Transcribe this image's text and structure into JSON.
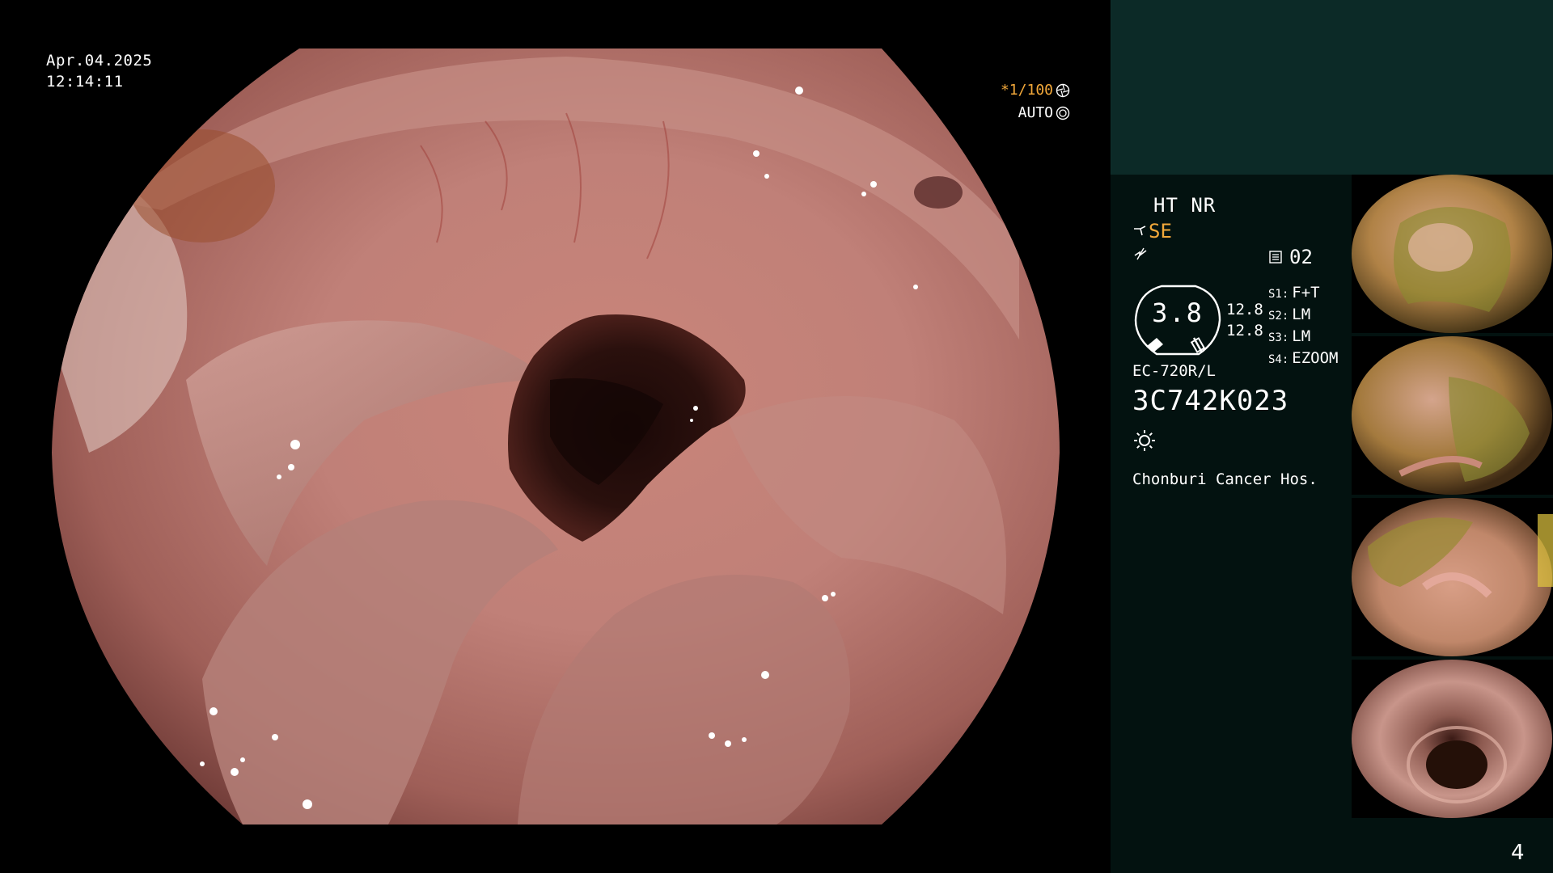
{
  "overlay": {
    "date": "Apr.04.2025",
    "time": "12:14:11",
    "shutter": "*1/100",
    "mode": "AUTO"
  },
  "panel": {
    "ht_nr": "HT NR",
    "se": "SE",
    "channel": "02",
    "gauge_value": "3.8",
    "side_values": [
      "12.8",
      "12.8"
    ],
    "s_settings": [
      {
        "key": "S1:",
        "value": "F+T"
      },
      {
        "key": "S2:",
        "value": "LM"
      },
      {
        "key": "S3:",
        "value": "LM"
      },
      {
        "key": "S4:",
        "value": "EZOOM"
      }
    ],
    "model": "EC-720R/L",
    "serial": "3C742K023",
    "hospital": "Chonburi Cancer Hos."
  },
  "page_number": "4",
  "colors": {
    "orange_accent": "#f2a83a",
    "panel_top": "#0c2a27",
    "panel_bg": "#031210"
  },
  "icons": [
    "shutter-icon",
    "auto-iris-icon",
    "scope-icon",
    "noise-reduction-icon",
    "channel-icon",
    "light-icon"
  ]
}
